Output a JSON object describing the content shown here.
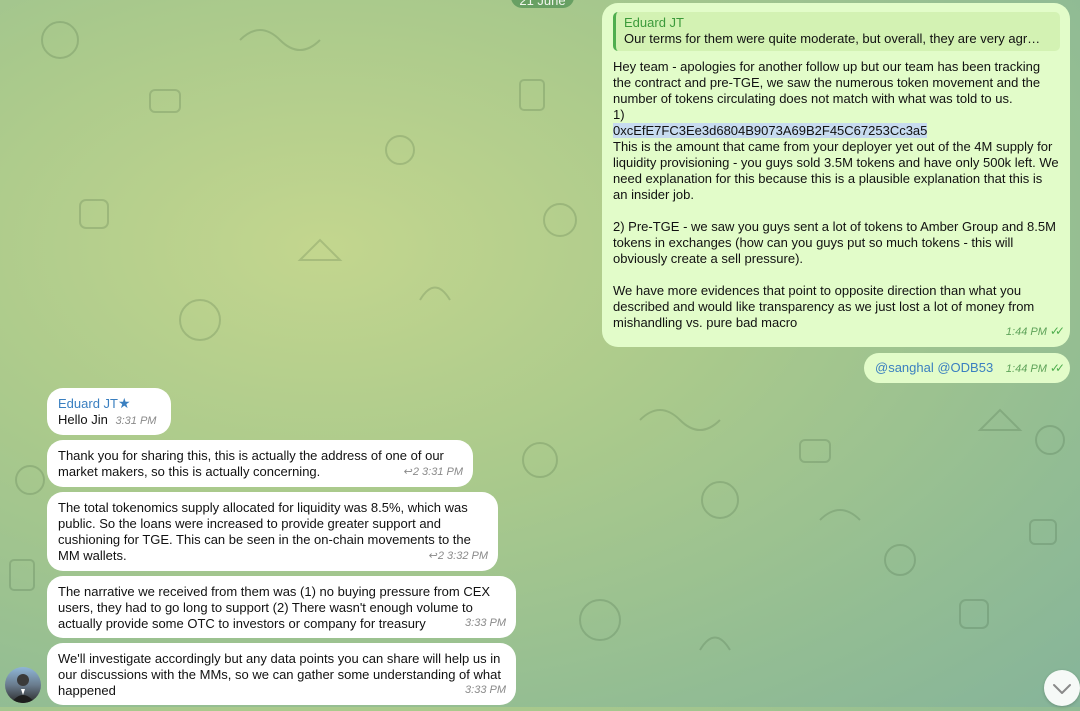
{
  "date_separator": "21 June",
  "outgoing": [
    {
      "reply_to": {
        "name": "Eduard JT",
        "text": "Our terms for them were quite moderate, but overall, they are very agr…"
      },
      "paragraphs": [
        "Hey team - apologies for another follow up but our team has been tracking the contract and pre-TGE, we saw the numerous token movement and the number of tokens circulating does not match with what was told to us.",
        "1)",
        "0xcEfE7FC3Ee3d6804B9073A69B2F45C67253Cc3a5",
        "This is the amount that came from your deployer yet out of the 4M supply for liquidity provisioning - you guys sold 3.5M tokens and have only 500k left. We need explanation for this because this is a plausible explanation that this is an insider job.",
        "2) Pre-TGE - we saw you guys sent a lot of tokens to Amber Group and 8.5M tokens in exchanges (how can you guys put so much tokens - this will obviously create a sell pressure).",
        "We have more evidences that point to opposite direction than what you described and would like transparency as we just lost a lot of money from mishandling vs. pure bad macro"
      ],
      "time": "1:44 PM"
    },
    {
      "text": "@sanghal @ODB53",
      "time": "1:44 PM"
    }
  ],
  "incoming": [
    {
      "sender": "Eduard JT",
      "text": "Hello Jin",
      "time": "3:31 PM"
    },
    {
      "text": "Thank you for sharing this, this is actually the address of one of our market makers, so this is actually concerning.",
      "replies": "2",
      "time": "3:31 PM"
    },
    {
      "text": "The total tokenomics supply allocated for liquidity was 8.5%, which was public. So the loans were increased to provide greater support and cushioning for TGE. This can be seen in the on-chain movements to the MM wallets.",
      "replies": "2",
      "time": "3:32 PM"
    },
    {
      "text": "The narrative we received from them was (1) no buying pressure from CEX users, they had to go long to support (2) There wasn't enough volume to actually provide some OTC to investors or company for treasury",
      "time": "3:33 PM"
    },
    {
      "text": "We'll investigate accordingly but any data points you can share will help us in our discussions with the MMs, so we can gather some understanding of what happened",
      "time": "3:33 PM"
    }
  ]
}
